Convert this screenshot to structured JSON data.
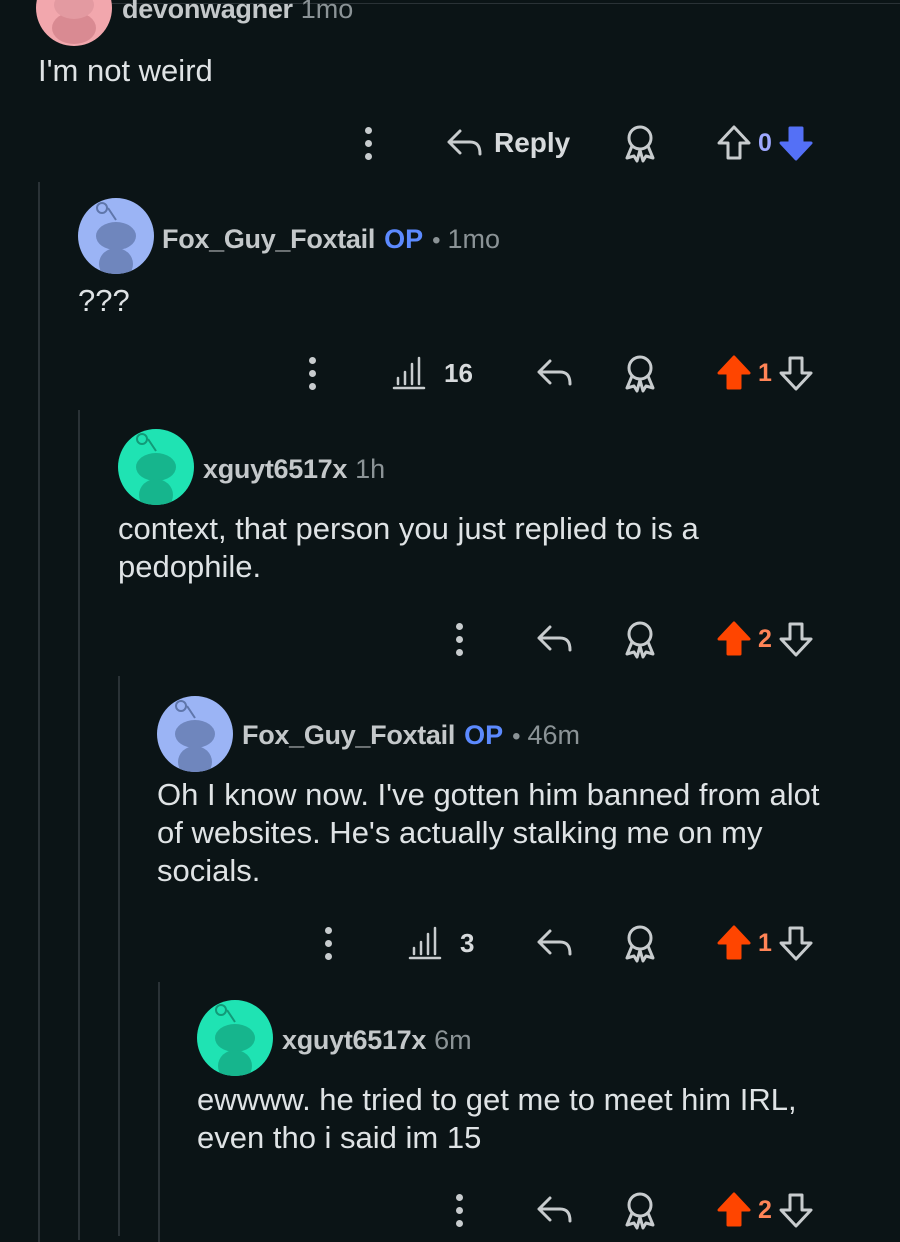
{
  "colors": {
    "background": "#0b1416",
    "op_badge": "#5c8aff",
    "upvote_active": "#ff4500",
    "upvote_count": "#ff8457",
    "downvote_active": "#5470f6",
    "downvote_count": "#9ea8ff"
  },
  "comments": [
    {
      "username": "devonwagner",
      "time": "1mo",
      "body": "I'm not weird",
      "actions": {
        "reply_label": "Reply",
        "score": "0",
        "vote": "down"
      }
    },
    {
      "username": "Fox_Guy_Foxtail",
      "op_badge": "OP",
      "separator": "•",
      "time": "1mo",
      "body": "???",
      "actions": {
        "views": "16",
        "score": "1",
        "vote": "up"
      }
    },
    {
      "username": "xguyt6517x",
      "time": "1h",
      "body": "context, that person you just replied to is a\npedophile.",
      "actions": {
        "score": "2",
        "vote": "up"
      }
    },
    {
      "username": "Fox_Guy_Foxtail",
      "op_badge": "OP",
      "separator": "•",
      "time": "46m",
      "body": "Oh I know now. I've gotten him banned from alot\nof websites. He's actually stalking me on my\nsocials.",
      "actions": {
        "views": "3",
        "score": "1",
        "vote": "up"
      }
    },
    {
      "username": "xguyt6517x",
      "time": "6m",
      "body": "ewwww. he tried to get me to meet him IRL,\neven tho i said im 15",
      "actions": {
        "score": "2",
        "vote": "up"
      }
    }
  ],
  "icons": {
    "more": "more-vertical-icon",
    "reply": "reply-arrow-icon",
    "award": "award-icon",
    "upvote": "upvote-arrow-icon",
    "downvote": "downvote-arrow-icon",
    "views": "bar-chart-icon"
  }
}
